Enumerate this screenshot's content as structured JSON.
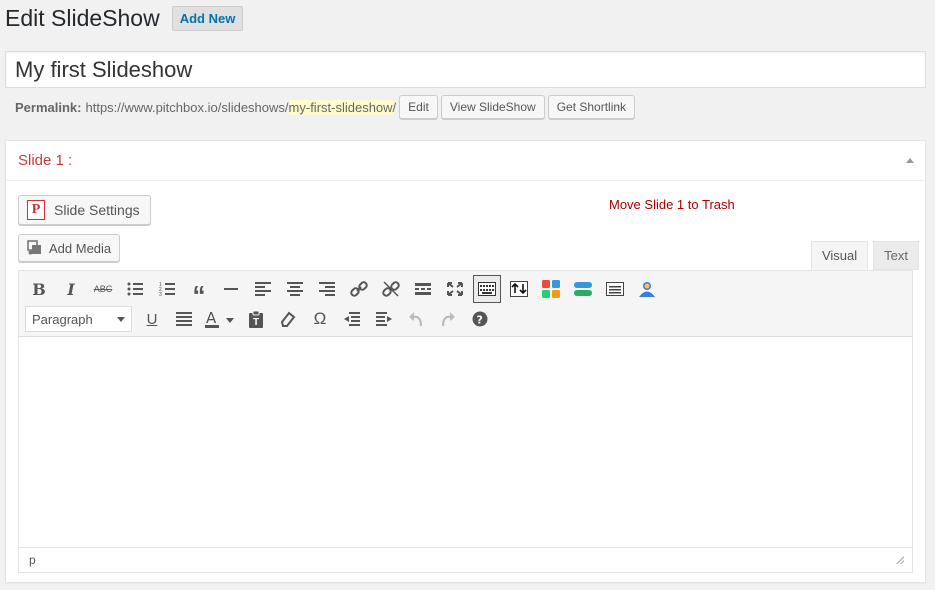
{
  "header": {
    "title": "Edit SlideShow",
    "add_new_label": "Add New"
  },
  "post_title": {
    "value": "My first Slideshow"
  },
  "permalink": {
    "label": "Permalink:",
    "base_url": "https://www.pitchbox.io/slideshows/",
    "slug": "my-first-slideshow",
    "trailing": "/",
    "edit_label": "Edit",
    "view_label": "View SlideShow",
    "shortlink_label": "Get Shortlink"
  },
  "slide": {
    "title": "Slide 1 :",
    "settings_label": "Slide Settings",
    "settings_badge": "P",
    "trash_label": "Move Slide 1 to Trash",
    "add_media_label": "Add Media"
  },
  "editor": {
    "tabs": [
      {
        "label": "Visual",
        "active": true
      },
      {
        "label": "Text",
        "active": false
      }
    ],
    "format_value": "Paragraph",
    "status_path": "p",
    "content": ""
  },
  "toolbar_row1": [
    "bold-icon",
    "italic-icon",
    "strikethrough-icon",
    "bulleted-list-icon",
    "numbered-list-icon",
    "blockquote-icon",
    "horizontal-line-icon",
    "align-left-icon",
    "align-center-icon",
    "align-right-icon",
    "insert-link-icon",
    "remove-link-icon",
    "read-more-icon",
    "fullscreen-icon",
    "toolbar-toggle-icon",
    "upload-icon",
    "grid-icon",
    "layers-icon",
    "notes-icon",
    "user-icon"
  ],
  "toolbar_row2": [
    "format-select",
    "underline-icon",
    "justify-icon",
    "text-color-icon",
    "paste-text-icon",
    "clear-format-icon",
    "special-char-icon",
    "outdent-icon",
    "indent-icon",
    "undo-icon",
    "redo-icon",
    "help-icon"
  ],
  "colors": {
    "accent": "#0073aa",
    "slide_title": "#c93c3c",
    "trash": "#a00000",
    "slug_highlight": "#fffbcc"
  }
}
